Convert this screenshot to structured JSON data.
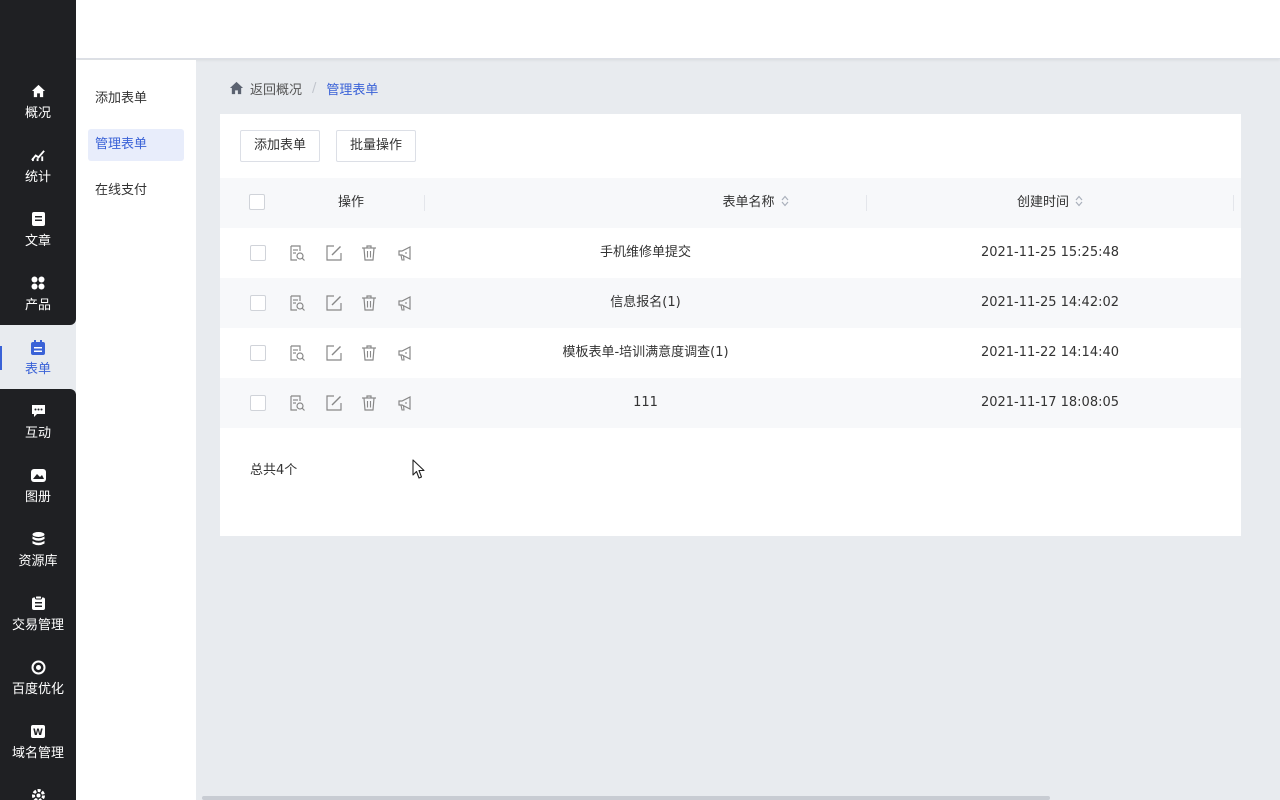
{
  "nav": {
    "items": [
      {
        "label": "概况",
        "icon": "home-icon"
      },
      {
        "label": "统计",
        "icon": "chart-icon"
      },
      {
        "label": "文章",
        "icon": "article-icon"
      },
      {
        "label": "产品",
        "icon": "product-icon"
      },
      {
        "label": "表单",
        "icon": "form-icon",
        "active": true
      },
      {
        "label": "互动",
        "icon": "chat-icon"
      },
      {
        "label": "图册",
        "icon": "album-icon"
      },
      {
        "label": "资源库",
        "icon": "database-icon"
      },
      {
        "label": "交易管理",
        "icon": "clipboard-icon"
      },
      {
        "label": "百度优化",
        "icon": "target-icon"
      },
      {
        "label": "域名管理",
        "icon": "domain-icon"
      }
    ],
    "accent": "#3a62d7"
  },
  "subnav": {
    "items": [
      "添加表单",
      "管理表单",
      "在线支付"
    ],
    "active": "管理表单"
  },
  "breadcrumb": {
    "back": "返回概况",
    "separator": "/",
    "current": "管理表单"
  },
  "toolbar": {
    "add_label": "添加表单",
    "batch_label": "批量操作"
  },
  "table": {
    "columns": [
      "操作",
      "表单名称",
      "创建时间"
    ],
    "rows": [
      {
        "name": "手机维修单提交",
        "created": "2021-11-25 15:25:48"
      },
      {
        "name": "信息报名(1)",
        "created": "2021-11-25 14:42:02"
      },
      {
        "name": "模板表单-培训满意度调查(1)",
        "created": "2021-11-22 14:14:40"
      },
      {
        "name": "111",
        "created": "2021-11-17 18:08:05"
      }
    ],
    "row_actions": [
      "view-icon",
      "edit-icon",
      "delete-icon",
      "publish-icon"
    ]
  },
  "footer": {
    "total": "总共4个"
  }
}
